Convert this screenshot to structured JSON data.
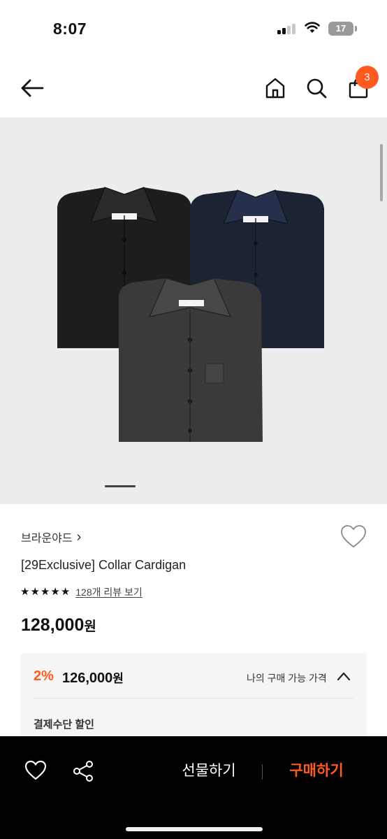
{
  "status_bar": {
    "time": "8:07",
    "battery": "17"
  },
  "header": {
    "cart_badge_count": "3",
    "icons": [
      "back-arrow-icon",
      "home-icon",
      "search-icon",
      "shopping-bag-icon"
    ]
  },
  "product": {
    "brand": "브라운야드",
    "brand_chevron": "›",
    "title": "[29Exclusive] Collar Cardigan",
    "rating_stars": 5,
    "review_link": "128개 리뷰 보기",
    "price": "128,000",
    "price_unit": "원",
    "image_colors": [
      "#1d1d1d",
      "#1c2434",
      "#3a3a3a"
    ],
    "carousel_current": 1
  },
  "discount_box": {
    "percent": "2%",
    "price": "126,000",
    "price_unit": "원",
    "my_price_label": "나의 구매 가능 가격",
    "payment_discount_label": "결제수단 할인"
  },
  "bottom_bar": {
    "gift_label": "선물하기",
    "buy_label": "구매하기",
    "accent_color": "#ff5a1f"
  }
}
